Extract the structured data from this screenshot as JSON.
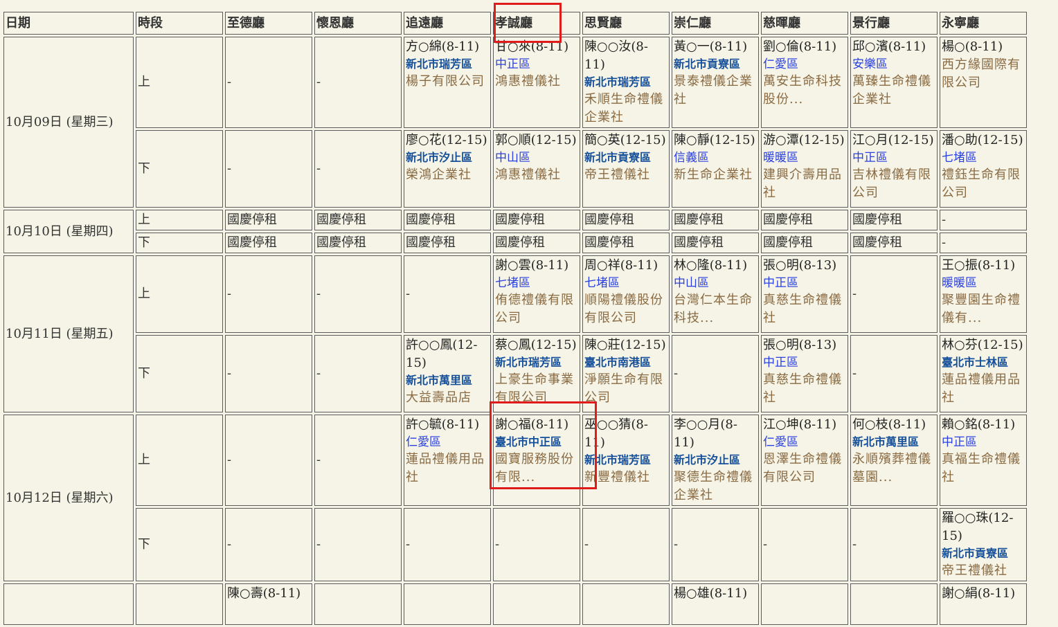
{
  "columns": [
    "日期",
    "時段",
    "至德廳",
    "懷恩廳",
    "追遠廳",
    "孝誠廳",
    "思賢廳",
    "崇仁廳",
    "慈暉廳",
    "景行廳",
    "永寧廳"
  ],
  "days": [
    {
      "date": "10月09日 (星期三)",
      "rows": [
        {
          "period": "上",
          "cells": [
            {
              "text": "-"
            },
            {
              "text": "-"
            },
            {
              "name": "方○綿(8-11)",
              "district": "新北市瑞芳區",
              "district_style": "bold",
              "org": "楊子有限公司"
            },
            {
              "name": "甘○來(8-11)",
              "district": "中正區",
              "district_style": "plain",
              "org": "鴻惠禮儀社"
            },
            {
              "name": "陳○○汝(8-11)",
              "district": "新北市瑞芳區",
              "district_style": "bold",
              "org": "禾順生命禮儀企業社"
            },
            {
              "name": "黃○一(8-11)",
              "district": "新北市貢寮區",
              "district_style": "bold",
              "org": "景泰禮儀企業社"
            },
            {
              "name": "劉○倫(8-11)",
              "district": "仁愛區",
              "district_style": "plain",
              "org": "萬安生命科技股份..."
            },
            {
              "name": "邱○濱(8-11)",
              "district": "安樂區",
              "district_style": "plain",
              "org": "萬臻生命禮儀企業社"
            },
            {
              "name": "楊○(8-11)",
              "district": "",
              "district_style": "none",
              "org": "西方緣國際有限公司"
            }
          ]
        },
        {
          "period": "下",
          "cells": [
            {
              "text": "-"
            },
            {
              "text": "-"
            },
            {
              "name": "廖○花(12-15)",
              "district": "新北市汐止區",
              "district_style": "bold",
              "org": "榮鴻企業社"
            },
            {
              "name": "郭○順(12-15)",
              "district": "中山區",
              "district_style": "plain",
              "org": "鴻惠禮儀社"
            },
            {
              "name": "簡○英(12-15)",
              "district": "新北市貢寮區",
              "district_style": "bold",
              "org": "帝王禮儀社"
            },
            {
              "name": "陳○靜(12-15)",
              "district": "信義區",
              "district_style": "plain",
              "org": "新生命企業社"
            },
            {
              "name": "游○潭(12-15)",
              "district": "暖暖區",
              "district_style": "plain",
              "org": "建興介壽用品社"
            },
            {
              "name": "江○月(12-15)",
              "district": "中正區",
              "district_style": "plain",
              "org": "吉林禮儀有限公司"
            },
            {
              "name": "潘○助(12-15)",
              "district": "七堵區",
              "district_style": "plain",
              "org": "禮鈺生命有限公司"
            }
          ]
        }
      ]
    },
    {
      "date": "10月10日 (星期四)",
      "rows": [
        {
          "period": "上",
          "cells": [
            {
              "text": "國慶停租"
            },
            {
              "text": "國慶停租"
            },
            {
              "text": "國慶停租"
            },
            {
              "text": "國慶停租"
            },
            {
              "text": "國慶停租"
            },
            {
              "text": "國慶停租"
            },
            {
              "text": "國慶停租"
            },
            {
              "text": "國慶停租"
            },
            {
              "text": "-"
            }
          ]
        },
        {
          "period": "下",
          "cells": [
            {
              "text": "國慶停租"
            },
            {
              "text": "國慶停租"
            },
            {
              "text": "國慶停租"
            },
            {
              "text": "國慶停租"
            },
            {
              "text": "國慶停租"
            },
            {
              "text": "國慶停租"
            },
            {
              "text": "國慶停租"
            },
            {
              "text": "國慶停租"
            },
            {
              "text": "-"
            }
          ]
        }
      ]
    },
    {
      "date": "10月11日 (星期五)",
      "rows": [
        {
          "period": "上",
          "cells": [
            {
              "text": "-"
            },
            {
              "text": "-"
            },
            {
              "text": "-"
            },
            {
              "name": "謝○雲(8-11)",
              "district": "七堵區",
              "district_style": "plain",
              "org": "侑德禮儀有限公司"
            },
            {
              "name": "周○祥(8-11)",
              "district": "七堵區",
              "district_style": "plain",
              "org": "順陽禮儀股份有限公司"
            },
            {
              "name": "林○隆(8-11)",
              "district": "中山區",
              "district_style": "plain",
              "org": "台灣仁本生命科技..."
            },
            {
              "name": "張○明(8-13)",
              "district": "中正區",
              "district_style": "plain",
              "org": "真慈生命禮儀社"
            },
            {
              "text": "-"
            },
            {
              "name": "王○振(8-11)",
              "district": "暖暖區",
              "district_style": "plain",
              "org": "聚豐園生命禮儀有..."
            }
          ]
        },
        {
          "period": "下",
          "cells": [
            {
              "text": "-"
            },
            {
              "text": "-"
            },
            {
              "name": "許○○鳳(12-15)",
              "district": "新北市萬里區",
              "district_style": "bold",
              "org": "大益壽品店"
            },
            {
              "name": "蔡○鳳(12-15)",
              "district": "新北市瑞芳區",
              "district_style": "bold",
              "org": "上豪生命事業有限公司"
            },
            {
              "name": "陳○莊(12-15)",
              "district": "臺北市南港區",
              "district_style": "bold",
              "org": "淨願生命有限公司"
            },
            {
              "text": "-"
            },
            {
              "name": "張○明(8-13)",
              "district": "中正區",
              "district_style": "plain",
              "org": "真慈生命禮儀社"
            },
            {
              "text": "-"
            },
            {
              "name": "林○芬(12-15)",
              "district": "臺北市士林區",
              "district_style": "bold",
              "org": "蓮品禮儀用品社"
            }
          ]
        }
      ]
    },
    {
      "date": "10月12日 (星期六)",
      "rows": [
        {
          "period": "上",
          "cells": [
            {
              "text": "-"
            },
            {
              "text": "-"
            },
            {
              "name": "許○毓(8-11)",
              "district": "仁愛區",
              "district_style": "plain",
              "org": "蓮品禮儀用品社"
            },
            {
              "name": "謝○福(8-11)",
              "district": "臺北市中正區",
              "district_style": "bold",
              "org": "國寶服務股份有限..."
            },
            {
              "name": "巫○○猜(8-11)",
              "district": "新北市瑞芳區",
              "district_style": "bold",
              "org": "新豐禮儀社"
            },
            {
              "name": "李○○月(8-11)",
              "district": "新北市汐止區",
              "district_style": "bold",
              "org": "聚德生命禮儀企業社"
            },
            {
              "name": "江○坤(8-11)",
              "district": "仁愛區",
              "district_style": "plain",
              "org": "恩澤生命禮儀有限公司"
            },
            {
              "name": "何○枝(8-11)",
              "district": "新北市萬里區",
              "district_style": "bold",
              "org": "永順殯葬禮儀墓園..."
            },
            {
              "name": "賴○銘(8-11)",
              "district": "中正區",
              "district_style": "plain",
              "org": "真福生命禮儀社"
            }
          ]
        },
        {
          "period": "下",
          "cells": [
            {
              "text": "-"
            },
            {
              "text": "-"
            },
            {
              "text": "-"
            },
            {
              "text": "-"
            },
            {
              "text": "-"
            },
            {
              "text": "-"
            },
            {
              "text": "-"
            },
            {
              "text": "-"
            },
            {
              "name": "羅○○珠(12-15)",
              "district": "新北市貢寮區",
              "district_style": "bold",
              "org": "帝王禮儀社"
            }
          ]
        }
      ]
    },
    {
      "date": "",
      "rows": [
        {
          "period": "",
          "cells": [
            {
              "name": "陳○壽(8-11)",
              "district": "",
              "district_style": "none",
              "org": ""
            },
            {
              "text": ""
            },
            {
              "text": ""
            },
            {
              "text": ""
            },
            {
              "text": ""
            },
            {
              "name": "楊○雄(8-11)",
              "district": "",
              "district_style": "none",
              "org": ""
            },
            {
              "text": ""
            },
            {
              "text": ""
            },
            {
              "name": "謝○絹(8-11)",
              "district": "",
              "district_style": "none",
              "org": ""
            }
          ]
        }
      ]
    }
  ],
  "highlights": [
    "header-xiaocheng",
    "cell-1012-am-xiaocheng"
  ],
  "colors": {
    "background": "#f5f4e6",
    "district_bold": "#16509a",
    "district_plain": "#2a3fe0",
    "org": "#8a6a42",
    "highlight": "#e01b1b"
  }
}
